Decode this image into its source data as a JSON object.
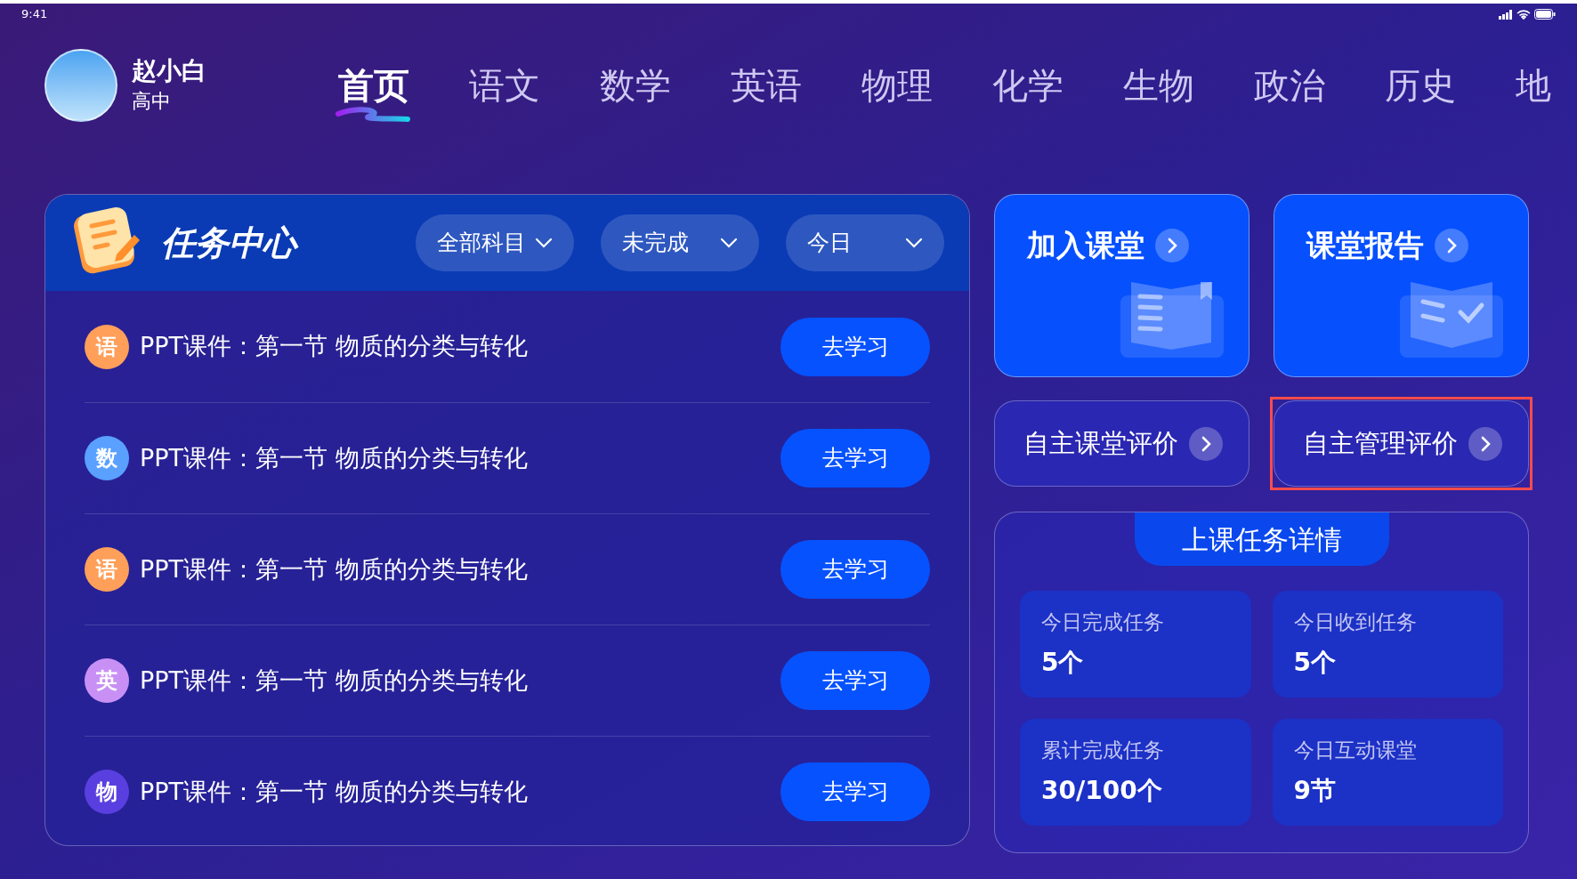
{
  "status_bar": {
    "time": "9:41"
  },
  "user": {
    "name": "赵小白",
    "grade": "高中"
  },
  "tabs": [
    {
      "label": "首页",
      "selected": true
    },
    {
      "label": "语文",
      "selected": false
    },
    {
      "label": "数学",
      "selected": false
    },
    {
      "label": "英语",
      "selected": false
    },
    {
      "label": "物理",
      "selected": false
    },
    {
      "label": "化学",
      "selected": false
    },
    {
      "label": "生物",
      "selected": false
    },
    {
      "label": "政治",
      "selected": false
    },
    {
      "label": "历史",
      "selected": false
    },
    {
      "label": "地",
      "selected": false
    }
  ],
  "task_center": {
    "title": "任务中心",
    "filters": [
      "全部科目",
      "未完成",
      "今日"
    ],
    "tasks": [
      {
        "subject": "语",
        "color": "#ff9f5a",
        "title": "PPT课件：第一节 物质的分类与转化",
        "action": "去学习"
      },
      {
        "subject": "数",
        "color": "#5aa0ff",
        "title": "PPT课件：第一节 物质的分类与转化",
        "action": "去学习"
      },
      {
        "subject": "语",
        "color": "#ff9f5a",
        "title": "PPT课件：第一节 物质的分类与转化",
        "action": "去学习"
      },
      {
        "subject": "英",
        "color": "#c890f5",
        "title": "PPT课件：第一节 物质的分类与转化",
        "action": "去学习"
      },
      {
        "subject": "物",
        "color": "#5a3fe0",
        "title": "PPT课件：第一节 物质的分类与转化",
        "action": "去学习"
      }
    ]
  },
  "quick_cards": [
    {
      "kind": "large",
      "label": "加入课堂",
      "highlighted": false
    },
    {
      "kind": "large",
      "label": "课堂报告",
      "highlighted": false
    },
    {
      "kind": "small",
      "label": "自主课堂评价",
      "highlighted": false
    },
    {
      "kind": "small",
      "label": "自主管理评价",
      "highlighted": true
    }
  ],
  "class_details": {
    "title": "上课任务详情",
    "stats": [
      {
        "label": "今日完成任务",
        "value": "5个"
      },
      {
        "label": "今日收到任务",
        "value": "5个"
      },
      {
        "label": "累计完成任务",
        "value": "30/100个"
      },
      {
        "label": "今日互动课堂",
        "value": "9节"
      }
    ]
  }
}
